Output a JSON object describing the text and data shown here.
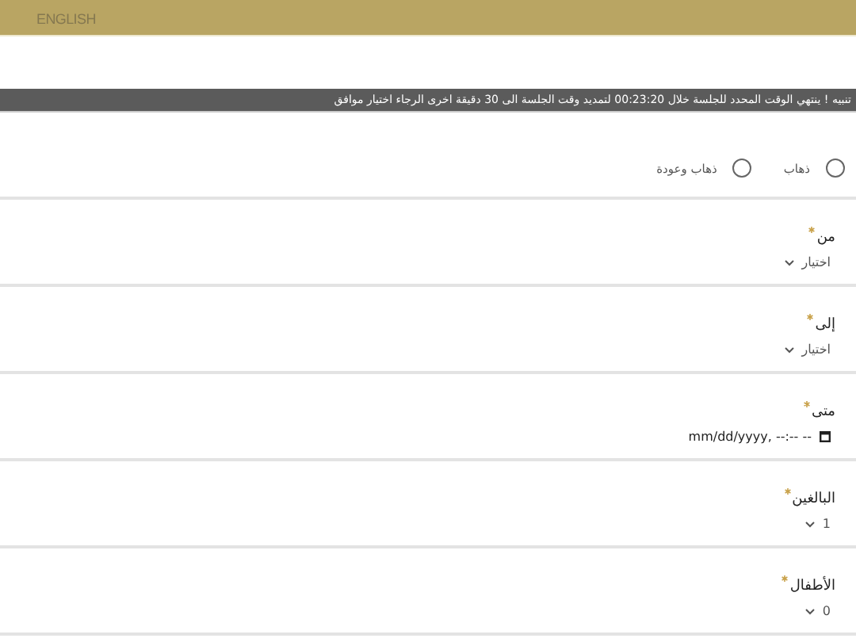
{
  "header": {
    "language_link": "ENGLISH"
  },
  "notice": "تنبيه ! ينتهي الوقت المحدد للجلسة خلال 00:23:20 لتمديد وقت الجلسة الى 30 دقيقة اخرى الرجاء اختيار موافق",
  "trip_type": [
    {
      "label": "ذهاب",
      "selected": false
    },
    {
      "label": "ذهاب وعودة",
      "selected": false
    }
  ],
  "fields": [
    {
      "label": "من",
      "required": true,
      "kind": "select",
      "value": "اختيار"
    },
    {
      "label": "إلى",
      "required": true,
      "kind": "select",
      "value": "اختيار"
    },
    {
      "label": "متى",
      "required": true,
      "kind": "datetime",
      "value": "mm/dd/yyyy, --:-- --"
    },
    {
      "label": "البالغين",
      "required": true,
      "kind": "select",
      "value": "1"
    },
    {
      "label": "الأطفال",
      "required": true,
      "kind": "select",
      "value": "0"
    }
  ]
}
